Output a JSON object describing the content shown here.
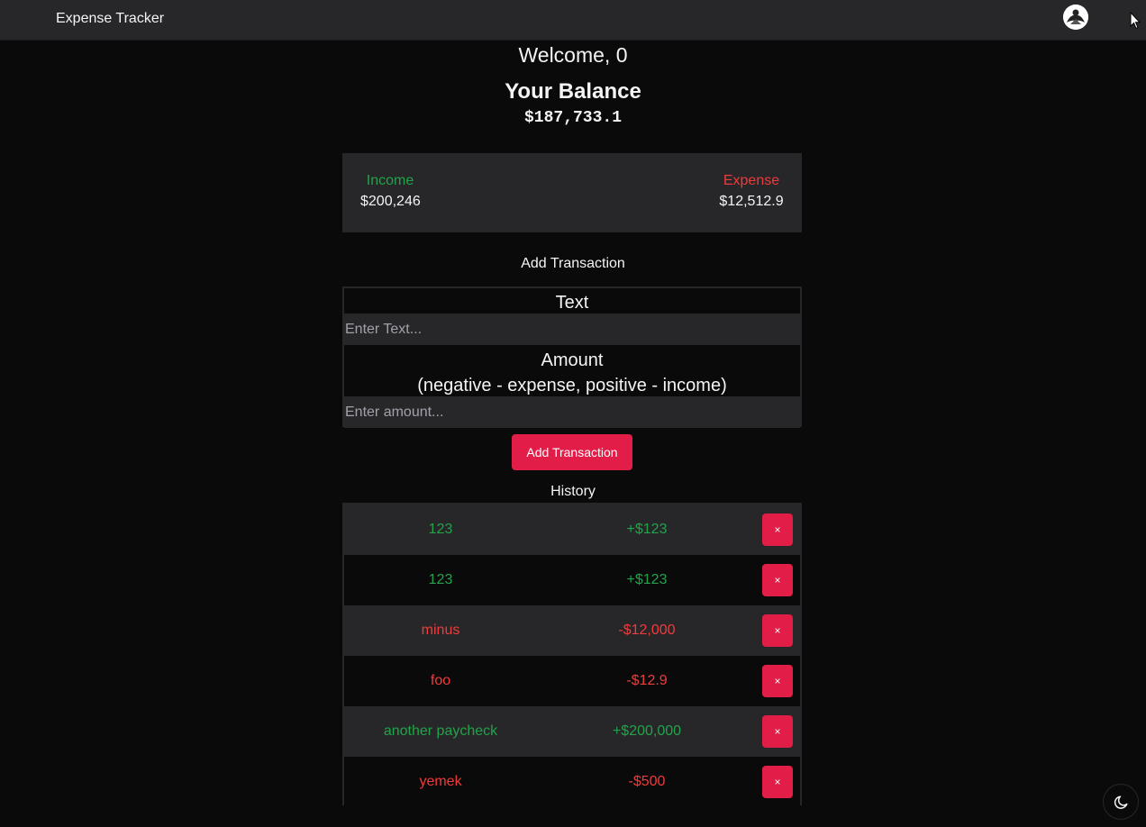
{
  "app": {
    "title": "Expense Tracker"
  },
  "header": {
    "welcome": "Welcome, 0",
    "balance_title": "Your Balance",
    "balance_value": "$187,733.1"
  },
  "summary": {
    "income_label": "Income",
    "income_value": "$200,246",
    "expense_label": "Expense",
    "expense_value": "$12,512.9"
  },
  "form": {
    "heading": "Add Transaction",
    "text_label": "Text",
    "text_placeholder": "Enter Text...",
    "amount_label": "Amount",
    "amount_hint": "(negative - expense, positive - income)",
    "amount_placeholder": "Enter amount...",
    "submit_label": "Add Transaction"
  },
  "history": {
    "heading": "History",
    "delete_label": "×",
    "items": [
      {
        "text": "123",
        "amount": "+$123",
        "type": "income"
      },
      {
        "text": "123",
        "amount": "+$123",
        "type": "income"
      },
      {
        "text": "minus",
        "amount": "-$12,000",
        "type": "expense"
      },
      {
        "text": "foo",
        "amount": "-$12.9",
        "type": "expense"
      },
      {
        "text": "another paycheck",
        "amount": "+$200,000",
        "type": "income"
      },
      {
        "text": "yemek",
        "amount": "-$500",
        "type": "expense"
      }
    ]
  },
  "colors": {
    "accent": "#e11d48",
    "income": "#22a34a",
    "expense": "#ef3b3b",
    "panel": "#27272a",
    "background": "#0a0a0a"
  },
  "icons": {
    "avatar": "avatar",
    "theme_toggle": "moon-icon"
  }
}
